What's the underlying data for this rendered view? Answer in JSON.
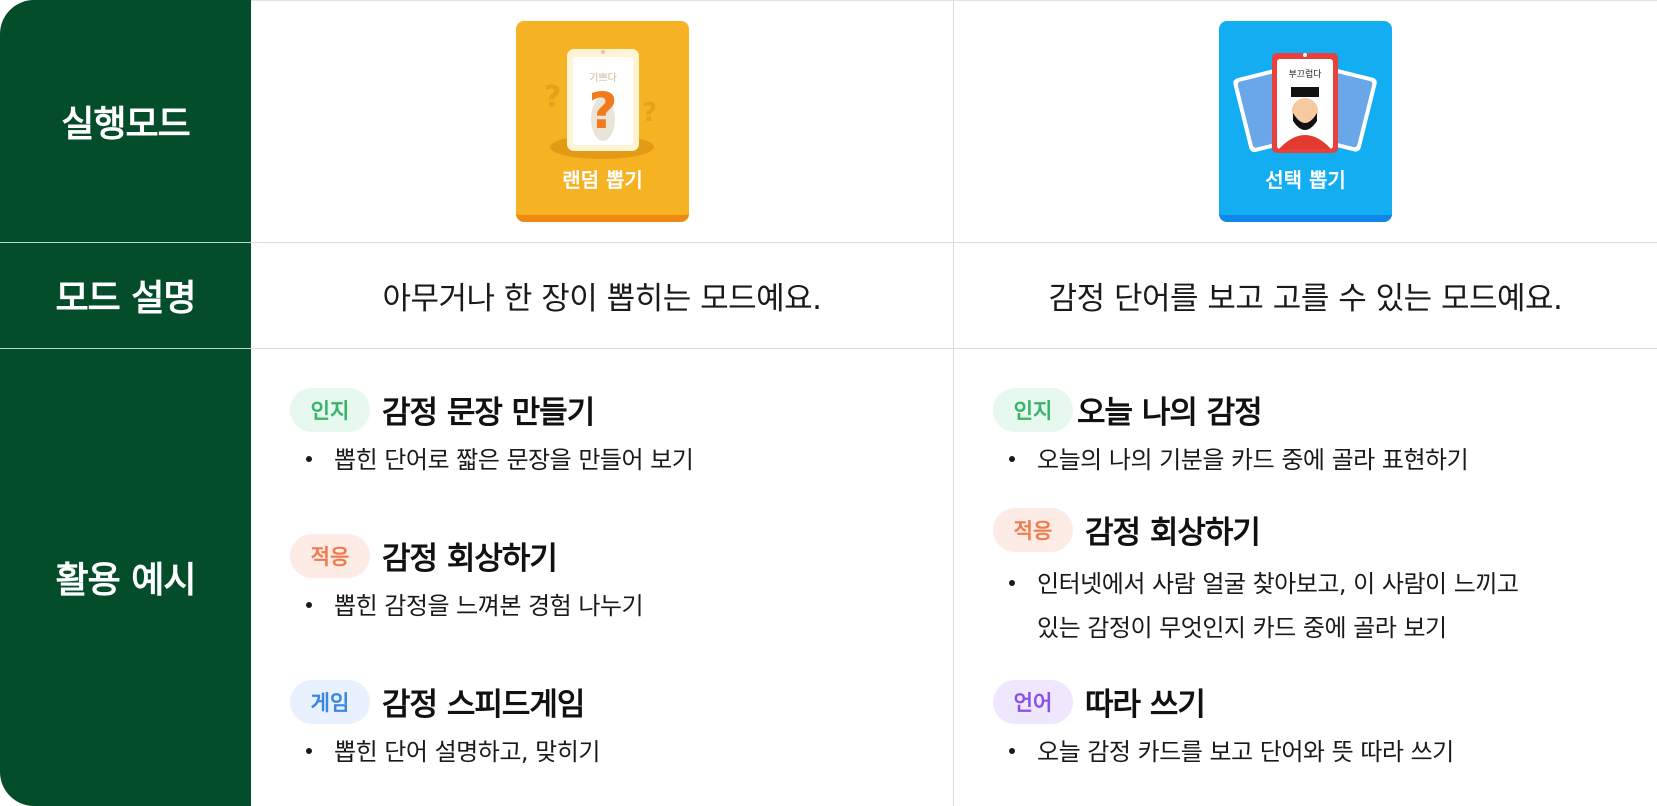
{
  "rows": {
    "mode": "실행모드",
    "description": "모드 설명",
    "examples": "활용 예시"
  },
  "modes": [
    {
      "card_label": "랜덤 뽑기",
      "card_color": "#f5b324",
      "card_word": "기쁘다",
      "description": "아무거나 한 장이 뽑히는 모드예요.",
      "sections": [
        {
          "tag": "인지",
          "tag_type": "cog",
          "title": "감정 문장 만들기",
          "bullets": [
            "뽑힌 단어로 짧은 문장을 만들어 보기"
          ]
        },
        {
          "tag": "적응",
          "tag_type": "adapt",
          "title": "감정 회상하기",
          "bullets": [
            "뽑힌 감정을 느껴본 경험 나누기"
          ]
        },
        {
          "tag": "게임",
          "tag_type": "game",
          "title": "감정 스피드게임",
          "bullets": [
            "뽑힌 단어 설명하고, 맞히기"
          ]
        }
      ]
    },
    {
      "card_label": "선택 뽑기",
      "card_color": "#13aef2",
      "card_word": "부끄럽다",
      "description": "감정 단어를 보고 고를 수 있는 모드예요.",
      "sections": [
        {
          "tag": "인지",
          "tag_type": "cog",
          "title": "오늘 나의 감정",
          "bullets": [
            "오늘의 나의 기분을 카드 중에 골라 표현하기"
          ]
        },
        {
          "tag": "적응",
          "tag_type": "adapt",
          "title": "감정 회상하기",
          "bullets": [
            "인터넷에서 사람 얼굴 찾아보고, 이 사람이 느끼고",
            "있는 감정이 무엇인지 카드 중에 골라 보기"
          ]
        },
        {
          "tag": "언어",
          "tag_type": "lang",
          "title": "따라 쓰기",
          "bullets": [
            "오늘 감정 카드를 보고 단어와 뜻 따라 쓰기"
          ]
        }
      ]
    }
  ]
}
